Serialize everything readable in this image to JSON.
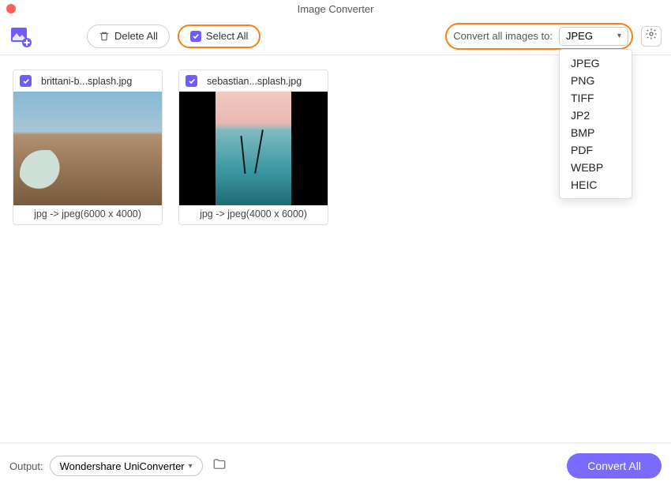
{
  "title": "Image Converter",
  "toolbar": {
    "delete_label": "Delete All",
    "select_all_label": "Select All",
    "convert_to_label": "Convert all images to:",
    "selected_format": "JPEG",
    "format_options": [
      "JPEG",
      "PNG",
      "TIFF",
      "JP2",
      "BMP",
      "PDF",
      "WEBP",
      "HEIC"
    ]
  },
  "cards": [
    {
      "name": "brittani-b...splash.jpg",
      "info": "jpg -> jpeg(6000 x 4000)"
    },
    {
      "name": "sebastian...splash.jpg",
      "info": "jpg -> jpeg(4000 x 6000)"
    }
  ],
  "footer": {
    "output_label": "Output:",
    "output_path": "Wondershare UniConverter",
    "convert_label": "Convert All"
  }
}
